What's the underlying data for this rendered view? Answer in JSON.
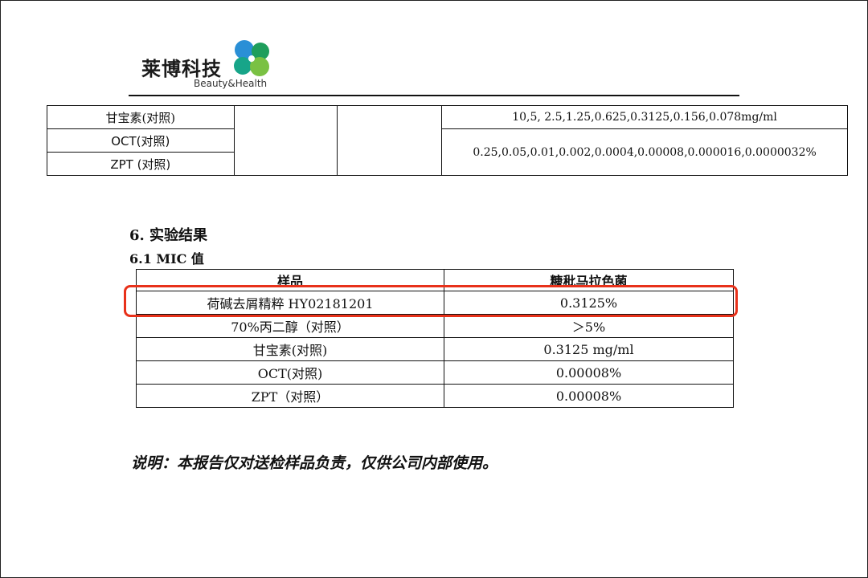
{
  "header": {
    "logo_cn": "莱博科技",
    "logo_en": "Beauty&Health",
    "logo_colors": [
      "#2a8fd6",
      "#1f9e5c",
      "#7ac143",
      "#17a589"
    ]
  },
  "top_table": {
    "rows": [
      {
        "sample": "甘宝素(对照)",
        "concentration": "10,5, 2.5,1.25,0.625,0.3125,0.156,0.078mg/ml"
      },
      {
        "sample": "OCT(对照)",
        "concentration": "0.25,0.05,0.01,0.002,0.0004,0.00008,0.000016,0.0000032%"
      },
      {
        "sample": "ZPT (对照)"
      }
    ]
  },
  "section": {
    "title": "6.  实验结果",
    "subtitle": "6.1 MIC 值"
  },
  "mic_table": {
    "headers": [
      "样品",
      "糠秕马拉色菌"
    ],
    "rows": [
      {
        "sample": "荷碱去屑精粹 HY02181201",
        "value": "0.3125%",
        "highlighted": true
      },
      {
        "sample": "70%丙二醇（对照）",
        "value": "＞5%"
      },
      {
        "sample": "甘宝素(对照)",
        "value": "0.3125 mg/ml"
      },
      {
        "sample": "OCT(对照)",
        "value": "0.00008%"
      },
      {
        "sample": "ZPT（对照）",
        "value": "0.00008%"
      }
    ],
    "highlight_color": "#e8311a"
  },
  "note": "说明：本报告仅对送检样品负责，仅供公司内部使用。"
}
